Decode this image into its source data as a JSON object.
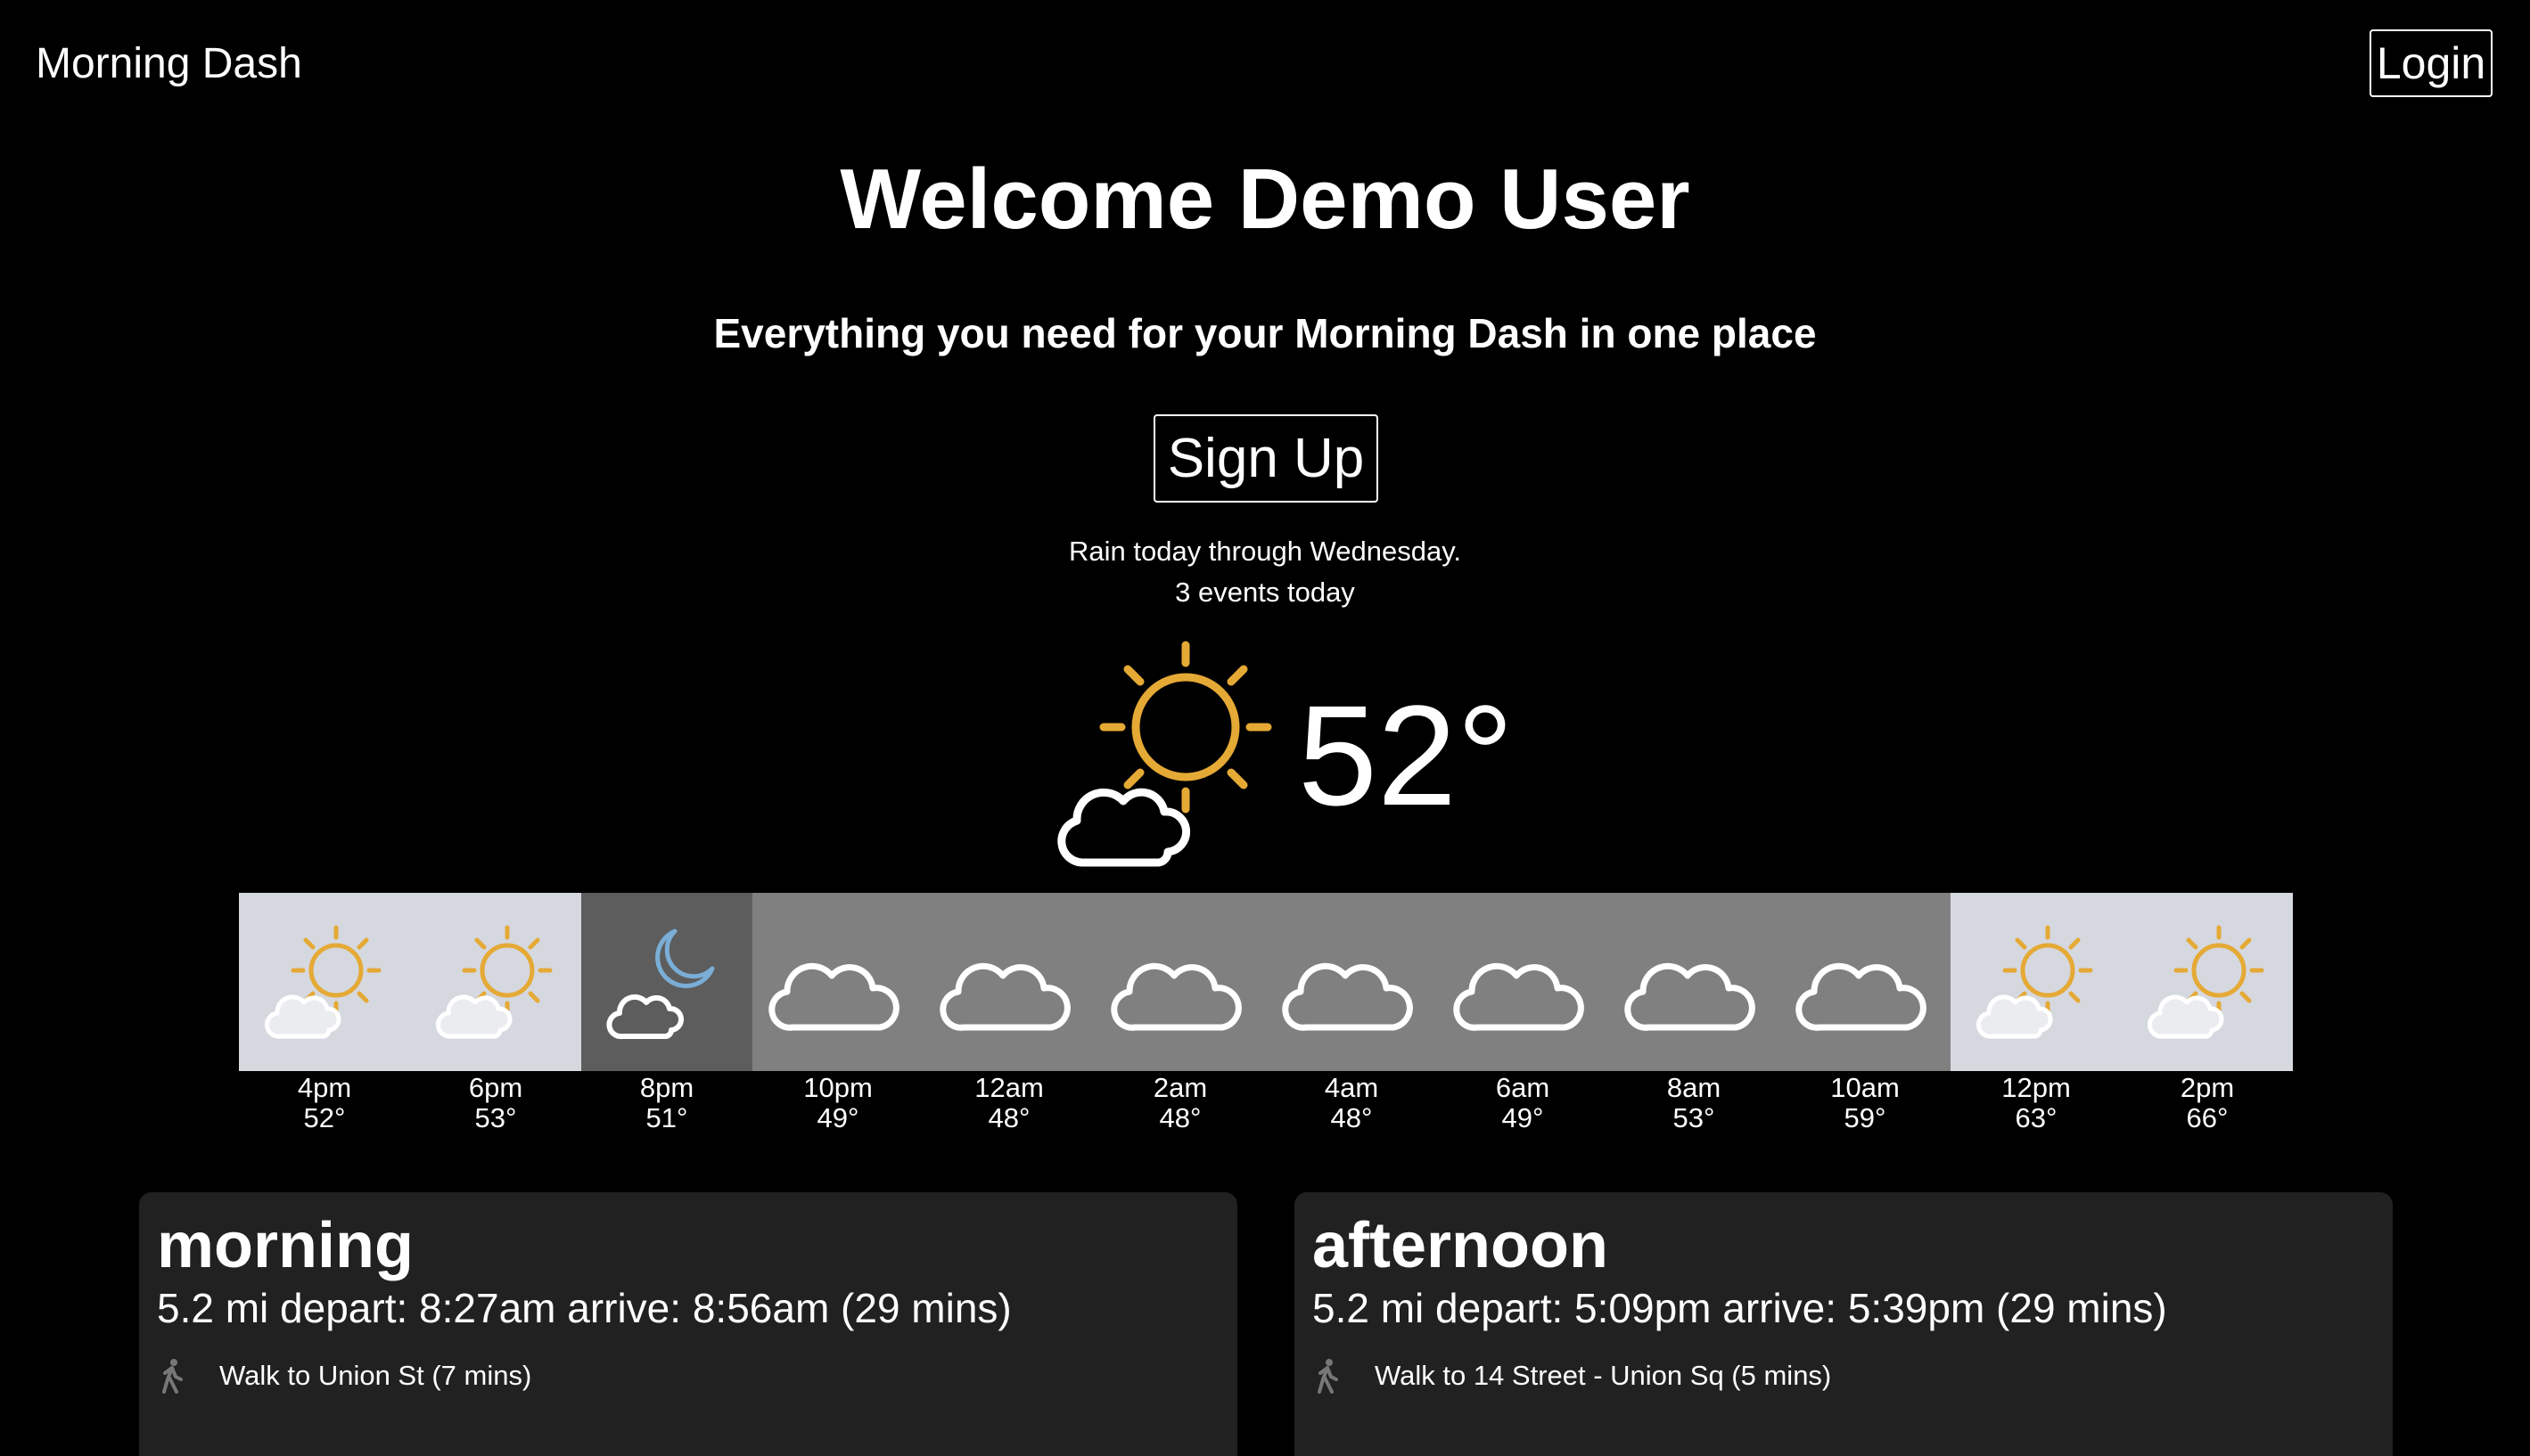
{
  "header": {
    "brand": "Morning Dash",
    "login_label": "Login"
  },
  "hero": {
    "title": "Welcome Demo User",
    "subtitle": "Everything you need for your Morning Dash in one place",
    "signup_label": "Sign Up"
  },
  "summary": {
    "weather_text": "Rain today through Wednesday.",
    "events_text": "3 events today"
  },
  "current_weather": {
    "temp": "52°",
    "icon": "partly-cloudy-day-icon"
  },
  "hourly": [
    {
      "time": "4pm",
      "temp": "52°",
      "icon": "partly-cloudy-day-icon",
      "condition": "day"
    },
    {
      "time": "6pm",
      "temp": "53°",
      "icon": "partly-cloudy-day-icon",
      "condition": "day"
    },
    {
      "time": "8pm",
      "temp": "51°",
      "icon": "partly-cloudy-night-icon",
      "condition": "night"
    },
    {
      "time": "10pm",
      "temp": "49°",
      "icon": "cloud-icon",
      "condition": "cloudy"
    },
    {
      "time": "12am",
      "temp": "48°",
      "icon": "cloud-icon",
      "condition": "cloudy"
    },
    {
      "time": "2am",
      "temp": "48°",
      "icon": "cloud-icon",
      "condition": "cloudy"
    },
    {
      "time": "4am",
      "temp": "48°",
      "icon": "cloud-icon",
      "condition": "cloudy"
    },
    {
      "time": "6am",
      "temp": "49°",
      "icon": "cloud-icon",
      "condition": "cloudy"
    },
    {
      "time": "8am",
      "temp": "53°",
      "icon": "cloud-icon",
      "condition": "cloudy"
    },
    {
      "time": "10am",
      "temp": "59°",
      "icon": "cloud-icon",
      "condition": "cloudy"
    },
    {
      "time": "12pm",
      "temp": "63°",
      "icon": "partly-cloudy-day-icon",
      "condition": "day"
    },
    {
      "time": "2pm",
      "temp": "66°",
      "icon": "partly-cloudy-day-icon",
      "condition": "day"
    }
  ],
  "commutes": [
    {
      "title": "morning",
      "trip": "5.2 mi depart: 8:27am arrive: 8:56am (29 mins)",
      "step": "Walk to Union St (7 mins)",
      "step_icon": "walking-icon"
    },
    {
      "title": "afternoon",
      "trip": "5.2 mi depart: 5:09pm arrive: 5:39pm (29 mins)",
      "step": "Walk to 14 Street - Union Sq (5 mins)",
      "step_icon": "walking-icon"
    }
  ],
  "colors": {
    "background": "#000000",
    "card": "#212121",
    "sun": "#e5a935",
    "moon": "#7aaed6",
    "day_cell": "#d5d8df",
    "night_cell": "#5d5d5d",
    "cloudy_cell": "#808080"
  }
}
